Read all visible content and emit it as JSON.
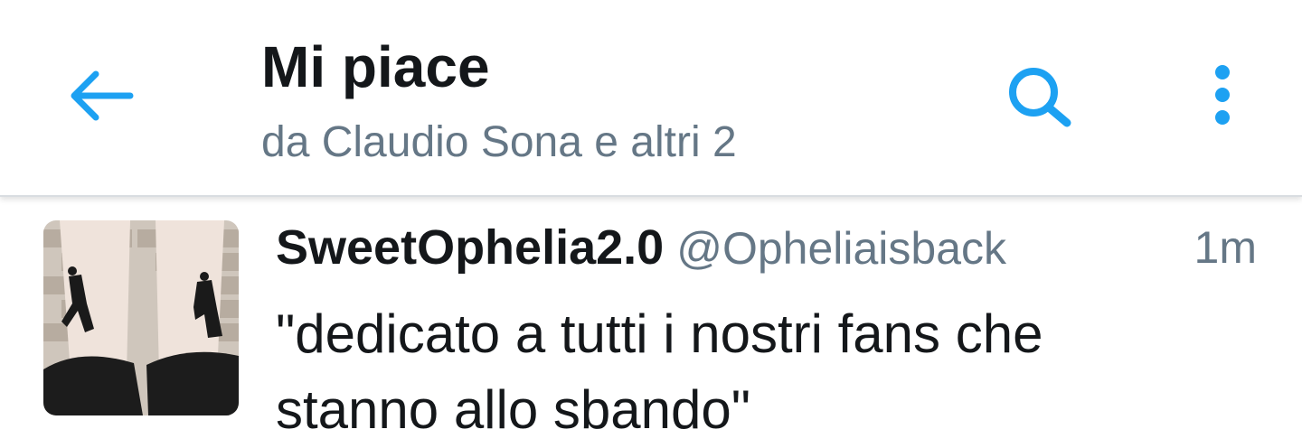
{
  "header": {
    "title": "Mi piace",
    "subtitle": "da Claudio Sona e altri 2",
    "back_icon": "arrow-left-icon",
    "search_icon": "search-icon",
    "more_icon": "more-vertical-icon"
  },
  "tweet": {
    "name": "SweetOphelia2.0",
    "handle": "@Opheliaisback",
    "time": "1m",
    "text": "\"dedicato a tutti i nostri fans che\nstanno allo sbando\""
  },
  "colors": {
    "accent": "#1da1f2",
    "text": "#14171a",
    "muted": "#657786"
  }
}
